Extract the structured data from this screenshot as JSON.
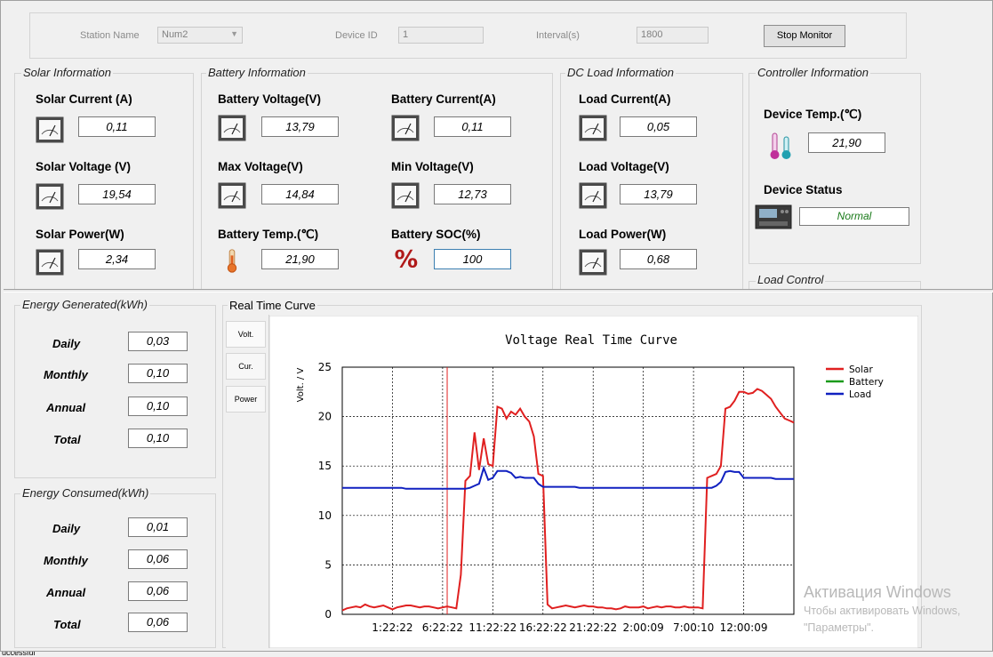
{
  "monitor": {
    "station_label": "Station Name",
    "station_value": "Num2",
    "device_id_label": "Device ID",
    "device_id_value": "1",
    "interval_label": "Interval(s)",
    "interval_value": "1800",
    "stop_button": "Stop Monitor"
  },
  "solar": {
    "group": "Solar Information",
    "current_label": "Solar Current (A)",
    "current": "0,11",
    "voltage_label": "Solar Voltage (V)",
    "voltage": "19,54",
    "power_label": "Solar Power(W)",
    "power": "2,34"
  },
  "battery": {
    "group": "Battery Information",
    "voltage_label": "Battery Voltage(V)",
    "voltage": "13,79",
    "current_label": "Battery Current(A)",
    "current": "0,11",
    "max_label": "Max Voltage(V)",
    "max": "14,84",
    "min_label": "Min Voltage(V)",
    "min": "12,73",
    "temp_label": "Battery Temp.(℃)",
    "temp": "21,90",
    "soc_label": "Battery SOC(%)",
    "soc": "100"
  },
  "load": {
    "group": "DC Load Information",
    "current_label": "Load Current(A)",
    "current": "0,05",
    "voltage_label": "Load Voltage(V)",
    "voltage": "13,79",
    "power_label": "Load Power(W)",
    "power": "0,68"
  },
  "controller": {
    "group": "Controller Information",
    "temp_label": "Device Temp.(℃)",
    "temp": "21,90",
    "status_label": "Device Status",
    "status": "Normal",
    "status_color": "#1a7a1a"
  },
  "load_control": {
    "group": "Load Control"
  },
  "energy_generated": {
    "group": "Energy Generated(kWh)",
    "rows": [
      {
        "label": "Daily",
        "value": "0,03"
      },
      {
        "label": "Monthly",
        "value": "0,10"
      },
      {
        "label": "Annual",
        "value": "0,10"
      },
      {
        "label": "Total",
        "value": "0,10"
      }
    ]
  },
  "energy_consumed": {
    "group": "Energy Consumed(kWh)",
    "rows": [
      {
        "label": "Daily",
        "value": "0,01"
      },
      {
        "label": "Monthly",
        "value": "0,06"
      },
      {
        "label": "Annual",
        "value": "0,06"
      },
      {
        "label": "Total",
        "value": "0,06"
      }
    ]
  },
  "curve": {
    "group": "Real Time Curve",
    "tabs": [
      "Volt.",
      "Cur.",
      "Power"
    ]
  },
  "chart_data": {
    "type": "line",
    "title": "Voltage Real Time Curve",
    "ylabel": "Volt. / V",
    "xlabel": "",
    "ylim": [
      0,
      25
    ],
    "yticks": [
      0,
      5,
      10,
      15,
      20,
      25
    ],
    "x_tick_labels": [
      "1:22:22",
      "6:22:22",
      "11:22:22",
      "16:22:22",
      "21:22:22",
      "2:00:09",
      "7:00:10",
      "12:00:09"
    ],
    "x_count": 100,
    "grid": true,
    "legend": "top-right",
    "series": [
      {
        "name": "Solar",
        "color": "#e02020",
        "values": [
          0.4,
          0.6,
          0.7,
          0.8,
          0.7,
          1.0,
          0.8,
          0.7,
          0.8,
          0.9,
          0.7,
          0.5,
          0.7,
          0.8,
          0.9,
          0.9,
          0.8,
          0.7,
          0.8,
          0.8,
          0.7,
          0.6,
          0.7,
          0.8,
          0.7,
          0.6,
          4.0,
          13.5,
          14.0,
          18.4,
          14.6,
          17.8,
          15.2,
          15.0,
          21.0,
          20.8,
          19.8,
          20.5,
          20.2,
          20.8,
          20.0,
          19.5,
          18.0,
          14.2,
          14.0,
          1.0,
          0.6,
          0.7,
          0.8,
          0.9,
          0.8,
          0.7,
          0.8,
          0.9,
          0.8,
          0.8,
          0.7,
          0.7,
          0.6,
          0.6,
          0.5,
          0.6,
          0.8,
          0.7,
          0.7,
          0.7,
          0.8,
          0.6,
          0.7,
          0.8,
          0.7,
          0.8,
          0.8,
          0.7,
          0.7,
          0.8,
          0.7,
          0.7,
          0.7,
          0.6,
          13.8,
          14.0,
          14.2,
          15.0,
          20.8,
          21.0,
          21.6,
          22.5,
          22.5,
          22.3,
          22.4,
          22.8,
          22.6,
          22.2,
          21.8,
          21.0,
          20.4,
          19.8,
          19.6,
          19.4
        ]
      },
      {
        "name": "Battery",
        "color": "#1a9a1a",
        "values": []
      },
      {
        "name": "Load",
        "color": "#1020c0",
        "values": [
          12.8,
          12.8,
          12.8,
          12.8,
          12.8,
          12.8,
          12.8,
          12.8,
          12.8,
          12.8,
          12.8,
          12.8,
          12.8,
          12.8,
          12.7,
          12.7,
          12.7,
          12.7,
          12.7,
          12.7,
          12.7,
          12.7,
          12.7,
          12.7,
          12.7,
          12.7,
          12.7,
          12.7,
          12.8,
          13.0,
          13.2,
          14.8,
          13.6,
          13.8,
          14.5,
          14.5,
          14.5,
          14.3,
          13.8,
          13.9,
          13.8,
          13.8,
          13.8,
          13.2,
          12.9,
          12.9,
          12.9,
          12.9,
          12.9,
          12.9,
          12.9,
          12.9,
          12.8,
          12.8,
          12.8,
          12.8,
          12.8,
          12.8,
          12.8,
          12.8,
          12.8,
          12.8,
          12.8,
          12.8,
          12.8,
          12.8,
          12.8,
          12.8,
          12.8,
          12.8,
          12.8,
          12.8,
          12.8,
          12.8,
          12.8,
          12.8,
          12.8,
          12.8,
          12.8,
          12.8,
          12.8,
          12.8,
          13.0,
          13.4,
          14.4,
          14.5,
          14.4,
          14.4,
          13.8,
          13.8,
          13.8,
          13.8,
          13.8,
          13.8,
          13.8,
          13.7,
          13.7,
          13.7,
          13.7,
          13.7
        ]
      }
    ],
    "cursor_index": 23
  },
  "watermark": {
    "line1": "Активация Windows",
    "line2": "Чтобы активировать Windows,",
    "line3": "\"Параметры\"."
  },
  "status_bar": {
    "text": "uccessful"
  },
  "colors": {
    "accent_focus": "#3c7fb1",
    "panel_bg": "#f0f0f0"
  }
}
